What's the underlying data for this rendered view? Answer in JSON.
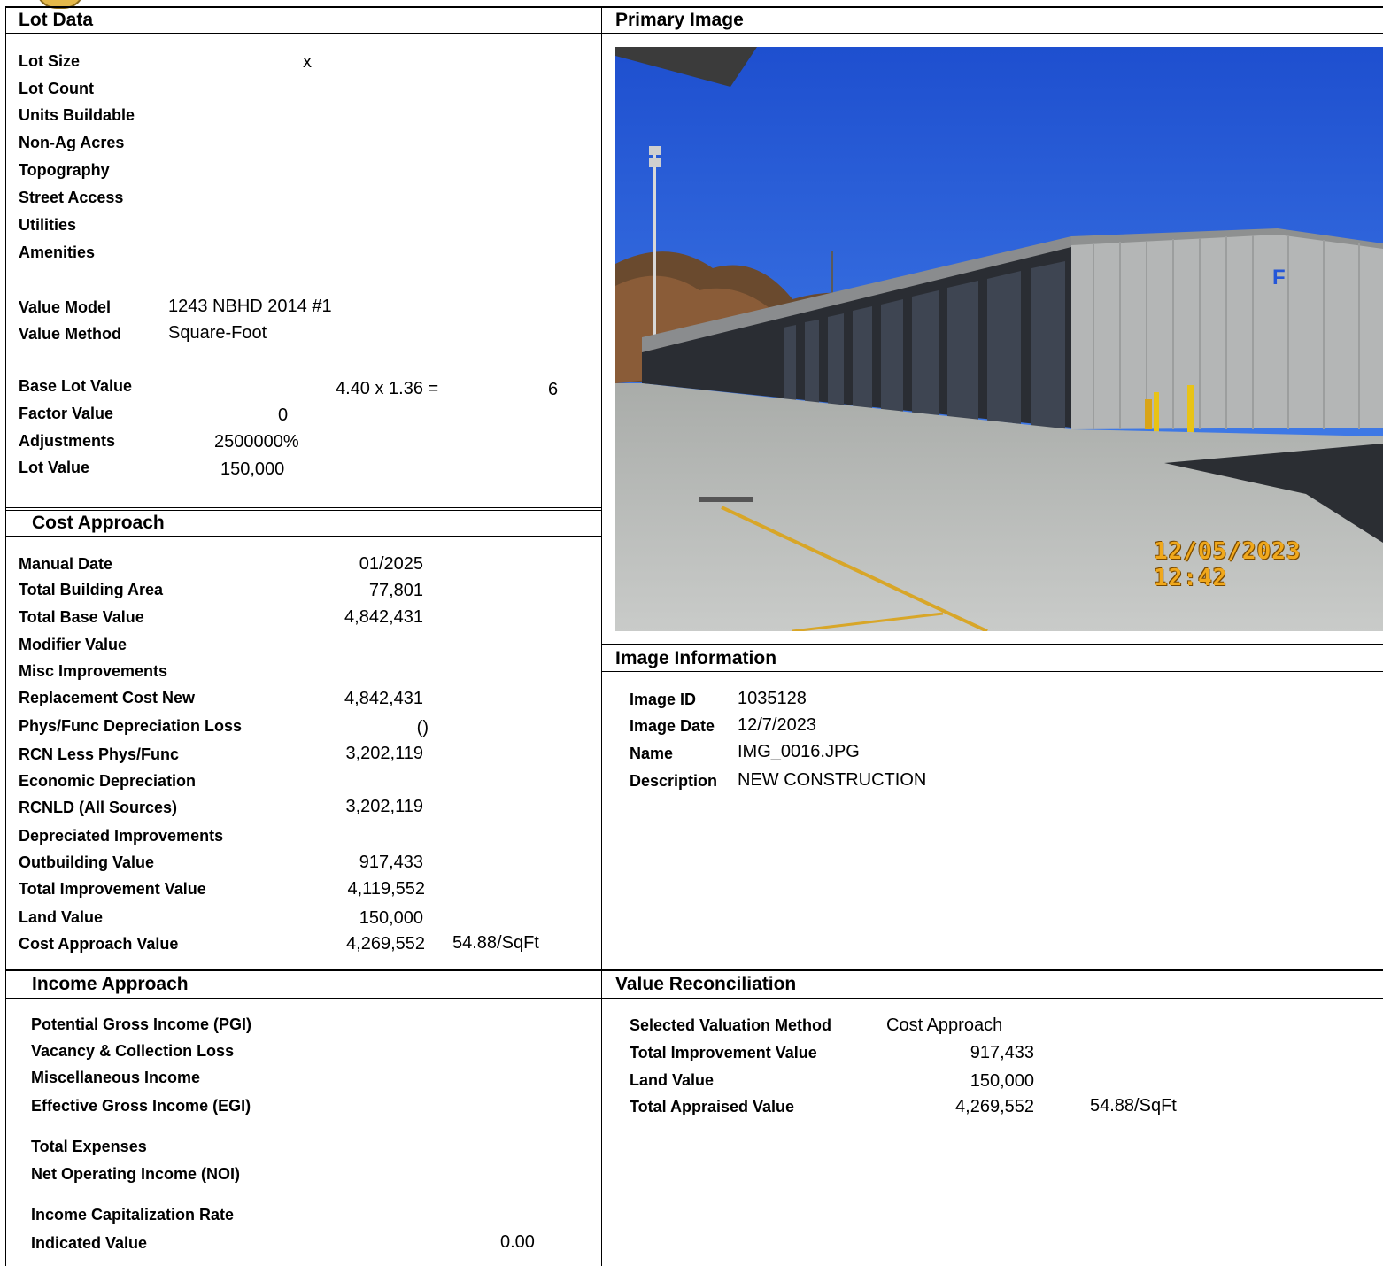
{
  "lot_data": {
    "header": "Lot Data",
    "labels": {
      "lot_size": "Lot Size",
      "lot_count": "Lot Count",
      "units_buildable": "Units Buildable",
      "non_ag_acres": "Non-Ag Acres",
      "topography": "Topography",
      "street_access": "Street Access",
      "utilities": "Utilities",
      "amenities": "Amenities",
      "value_model": "Value Model",
      "value_method": "Value Method",
      "base_lot_value": "Base Lot Value",
      "factor_value": "Factor Value",
      "adjustments": "Adjustments",
      "lot_value": "Lot Value"
    },
    "values": {
      "lot_size": "x",
      "value_model": "1243 NBHD 2014 #1",
      "value_method": "Square-Foot",
      "base_lot_formula": "4.40 x 1.36 =",
      "base_lot_result": "6",
      "factor_value": "0",
      "adjustments": "2500000%",
      "lot_value": "150,000"
    }
  },
  "primary_image": {
    "header": "Primary Image",
    "timestamp": "12/05/2023  12:42",
    "sign_letter": "F"
  },
  "cost_approach": {
    "header": "Cost Approach",
    "rows": [
      {
        "label": "Manual Date",
        "value": "01/2025"
      },
      {
        "label": "Total Building Area",
        "value": "77,801"
      },
      {
        "label": "Total Base Value",
        "value": "4,842,431"
      },
      {
        "label": "Modifier Value",
        "value": ""
      },
      {
        "label": "Misc Improvements",
        "value": ""
      },
      {
        "label": "Replacement Cost New",
        "value": "4,842,431"
      },
      {
        "label": "Phys/Func Depreciation Loss",
        "value": "()"
      },
      {
        "label": "RCN Less Phys/Func",
        "value": "3,202,119"
      },
      {
        "label": "Economic Depreciation",
        "value": ""
      },
      {
        "label": "RCNLD (All Sources)",
        "value": "3,202,119"
      },
      {
        "label": "Depreciated Improvements",
        "value": ""
      },
      {
        "label": "Outbuilding Value",
        "value": "917,433"
      },
      {
        "label": "Total Improvement Value",
        "value": "4,119,552"
      },
      {
        "label": "Land Value",
        "value": "150,000"
      },
      {
        "label": "Cost Approach Value",
        "value": "4,269,552"
      }
    ],
    "per_sqft": "54.88/SqFt"
  },
  "image_information": {
    "header": "Image Information",
    "rows": [
      {
        "label": "Image ID",
        "value": "1035128"
      },
      {
        "label": "Image Date",
        "value": "12/7/2023"
      },
      {
        "label": "Name",
        "value": "IMG_0016.JPG"
      },
      {
        "label": "Description",
        "value": "NEW CONSTRUCTION"
      }
    ]
  },
  "income_approach": {
    "header": "Income Approach",
    "labels": {
      "pgi": "Potential Gross Income (PGI)",
      "vacancy": "Vacancy & Collection Loss",
      "misc_income": "Miscellaneous Income",
      "egi": "Effective Gross Income (EGI)",
      "total_expenses": "Total Expenses",
      "noi": "Net Operating Income (NOI)",
      "cap_rate": "Income Capitalization Rate",
      "indicated_value": "Indicated Value"
    },
    "indicated_value": "0.00"
  },
  "value_reconciliation": {
    "header": "Value Reconciliation",
    "labels": {
      "method": "Selected Valuation Method",
      "total_improvement": "Total Improvement Value",
      "land_value": "Land Value",
      "total_appraised": "Total Appraised Value"
    },
    "values": {
      "method": "Cost Approach",
      "total_improvement": "917,433",
      "land_value": "150,000",
      "total_appraised": "4,269,552",
      "per_sqft": "54.88/SqFt"
    }
  }
}
